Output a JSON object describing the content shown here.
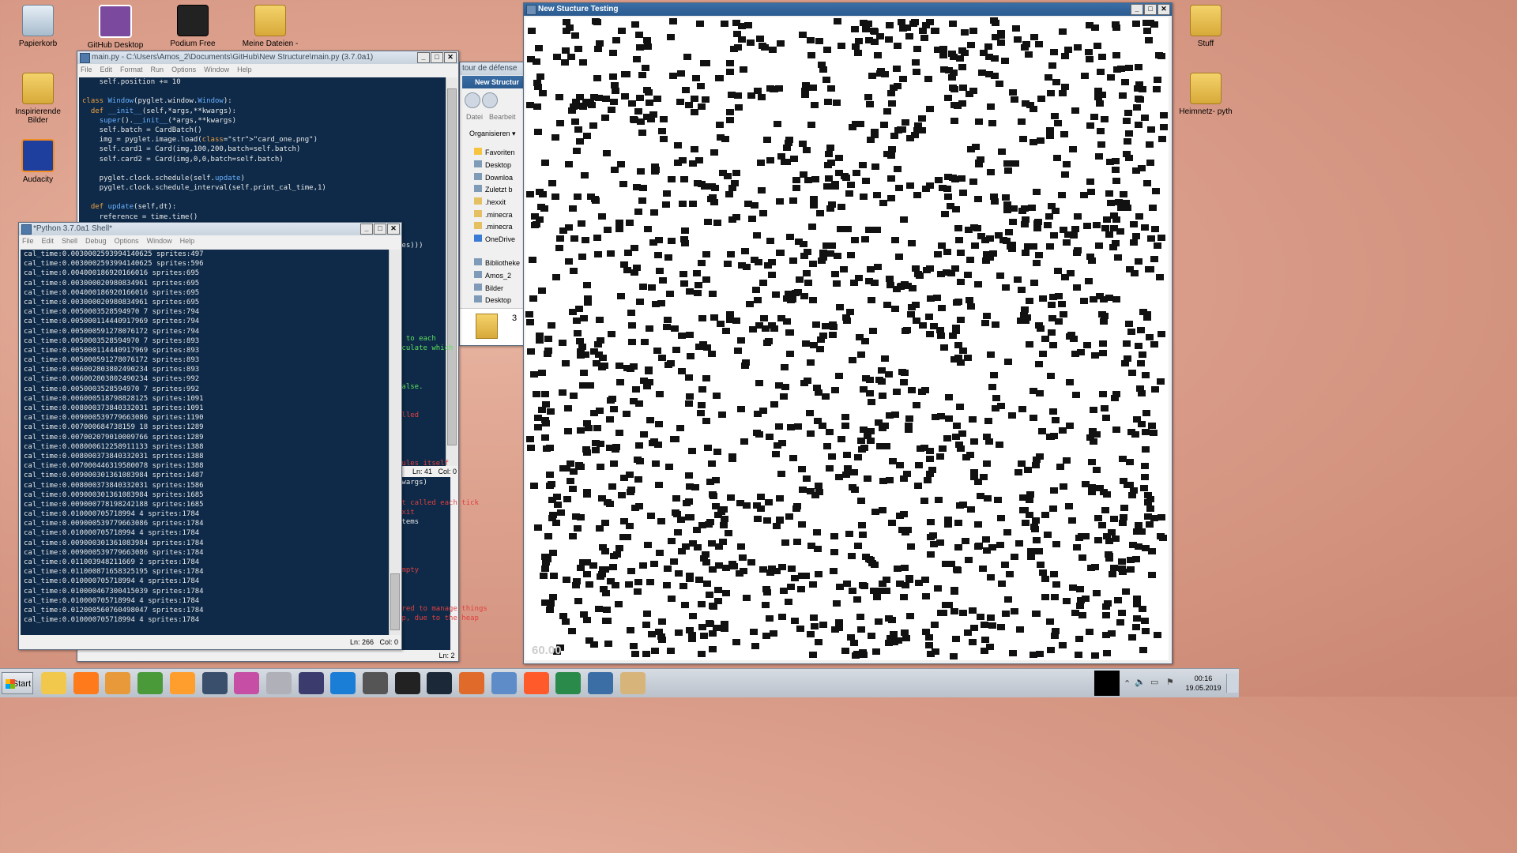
{
  "desktop": {
    "icons": [
      {
        "label": "Papierkorb",
        "kind": "recycle"
      },
      {
        "label": "GitHub Desktop",
        "kind": "github"
      },
      {
        "label": "Podium Free",
        "kind": "podium"
      },
      {
        "label": "Meine Dateien -",
        "kind": "folder"
      },
      {
        "label": "Inspirierende Bilder",
        "kind": "folder"
      },
      {
        "label": "Audacity",
        "kind": "audio"
      },
      {
        "label": "Stuff",
        "kind": "folder"
      },
      {
        "label": "Heimnetz- pyth",
        "kind": "folder"
      }
    ]
  },
  "editor": {
    "title": "main.py - C:\\Users\\Amos_2\\Documents\\GitHub\\New Structure\\main.py (3.7.0a1)",
    "menu": [
      "File",
      "Edit",
      "Format",
      "Run",
      "Options",
      "Window",
      "Help"
    ],
    "code_lines": [
      "    self.position += 10",
      "",
      "class Window(pyglet.window.Window):",
      "  def __init__(self,*args,**kwargs):",
      "    super().__init__(*args,**kwargs)",
      "    self.batch = CardBatch()",
      "    img = pyglet.image.load(\"card_one.png\")",
      "    self.card1 = Card(img,100,200,batch=self.batch)",
      "    self.card2 = Card(img,0,0,batch=self.batch)",
      "",
      "    pyglet.clock.schedule(self.update)",
      "    pyglet.clock.schedule_interval(self.print_cal_time,1)",
      "",
      "  def update(self,dt):",
      "    reference = time.time()"
    ],
    "right_fragments": [
      {
        "text": "tes)))",
        "tone": "plain"
      },
      {
        "text": "s to each",
        "tone": "str"
      },
      {
        "text": "lculate which",
        "tone": "str"
      },
      {
        "text": "False.",
        "tone": "str"
      },
      {
        "text": "alled",
        "tone": "cm"
      },
      {
        "text": "dules itself",
        "tone": "cm"
      },
      {
        "text": "):",
        "tone": "plain"
      },
      {
        "text": "kwargs)",
        "tone": "plain"
      },
      {
        "text": "ot called each tick",
        "tone": "cm"
      },
      {
        "text": "exit",
        "tone": "cm"
      },
      {
        "text": "items",
        "tone": "plain"
      },
      {
        "text": "empty",
        "tone": "cm"
      },
      {
        "text": "ired to manage things",
        "tone": "cm"
      },
      {
        "text": "cp, due to the heap",
        "tone": "cm"
      }
    ],
    "status_ln": "Ln: 41",
    "status_col": "Col: 0",
    "status_bottom": "Ln: 2"
  },
  "shell": {
    "title": "*Python 3.7.0a1 Shell*",
    "menu": [
      "File",
      "Edit",
      "Shell",
      "Debug",
      "Options",
      "Window",
      "Help"
    ],
    "lines": [
      "cal_time:0.0030002593994140625 sprites:497",
      "cal_time:0.0030002593994140625 sprites:596",
      "cal_time:0.004000186920166016 sprites:695",
      "cal_time:0.003000020980834961 sprites:695",
      "cal_time:0.004000186920166016 sprites:695",
      "cal_time:0.003000020980834961 sprites:695",
      "cal_time:0.0050003528594970 7 sprites:794",
      "cal_time:0.005000114440917969 sprites:794",
      "cal_time:0.005000591278076172 sprites:794",
      "cal_time:0.0050003528594970 7 sprites:893",
      "cal_time:0.005000114440917969 sprites:893",
      "cal_time:0.005000591278076172 sprites:893",
      "cal_time:0.006002803802490234 sprites:893",
      "cal_time:0.006002803802490234 sprites:992",
      "cal_time:0.0050003528594970 7 sprites:992",
      "cal_time:0.006000518798828125 sprites:1091",
      "cal_time:0.008000373840332031 sprites:1091",
      "cal_time:0.009000539779663086 sprites:1190",
      "cal_time:0.007000684738159 18 sprites:1289",
      "cal_time:0.007002079010009766 sprites:1289",
      "cal_time:0.008000612258911133 sprites:1388",
      "cal_time:0.008000373840332031 sprites:1388",
      "cal_time:0.007000446319580078 sprites:1388",
      "cal_time:0.009000301361083984 sprites:1487",
      "cal_time:0.008000373840332031 sprites:1586",
      "cal_time:0.009000301361083984 sprites:1685",
      "cal_time:0.009000778198242188 sprites:1685",
      "cal_time:0.010000705718994 4 sprites:1784",
      "cal_time:0.009000539779663086 sprites:1784",
      "cal_time:0.010000705718994 4 sprites:1784",
      "cal_time:0.009000301361083984 sprites:1784",
      "cal_time:0.009000539779663086 sprites:1784",
      "cal_time:0.011003948211669 2 sprites:1784",
      "cal_time:0.011000871658325195 sprites:1784",
      "cal_time:0.010000705718994 4 sprites:1784",
      "cal_time:0.010000467300415039 sprites:1784",
      "cal_time:0.010000705718994 4 sprites:1784",
      "cal_time:0.012000560760498047 sprites:1784",
      "cal_time:0.010000705718994 4 sprites:1784"
    ],
    "status_ln": "Ln: 266",
    "status_col": "Col: 0"
  },
  "explorer": {
    "back_title": "tour de défense",
    "title": "New Structur",
    "menu": [
      "Datei",
      "Bearbeit"
    ],
    "organize": "Organisieren",
    "nav": [
      {
        "label": "Favoriten",
        "icon": "star-icon"
      },
      {
        "label": "Desktop",
        "icon": "desktop-icon"
      },
      {
        "label": "Downloa",
        "icon": "downloads-icon"
      },
      {
        "label": "Zuletzt b",
        "icon": "recent-icon"
      },
      {
        "label": ".hexxit",
        "icon": "folder-icon"
      },
      {
        "label": ".minecra",
        "icon": "folder-icon"
      },
      {
        "label": ".minecra",
        "icon": "folder-icon"
      },
      {
        "label": "OneDrive",
        "icon": "cloud-icon"
      },
      {
        "label": "Bibliotheke",
        "icon": "library-icon"
      },
      {
        "label": "Amos_2",
        "icon": "user-icon"
      },
      {
        "label": "Bilder",
        "icon": "pictures-icon"
      },
      {
        "label": "Desktop",
        "icon": "desktop-icon"
      }
    ],
    "item_count": "3"
  },
  "pyglet": {
    "title": "New Stucture Testing",
    "fps": "60.00",
    "tile_count_shown": 1784
  },
  "taskbar": {
    "start_label": "Start",
    "apps": [
      "explorer",
      "firefox",
      "db",
      "charts",
      "media",
      "inkscape",
      "paint",
      "disc",
      "eclipse",
      "swirl",
      "headset",
      "epic-games",
      "steam",
      "maps",
      "gamepad",
      "firefox-dev",
      "sourcetree",
      "python",
      "paint-brush"
    ],
    "tray_time": "00:16",
    "tray_date": "19.05.2019"
  },
  "colors": {
    "code_bg": "#0e2a48",
    "keyword": "#f0a040",
    "function": "#6ab0ff",
    "string": "#5fe05f",
    "comment": "#e04040"
  }
}
